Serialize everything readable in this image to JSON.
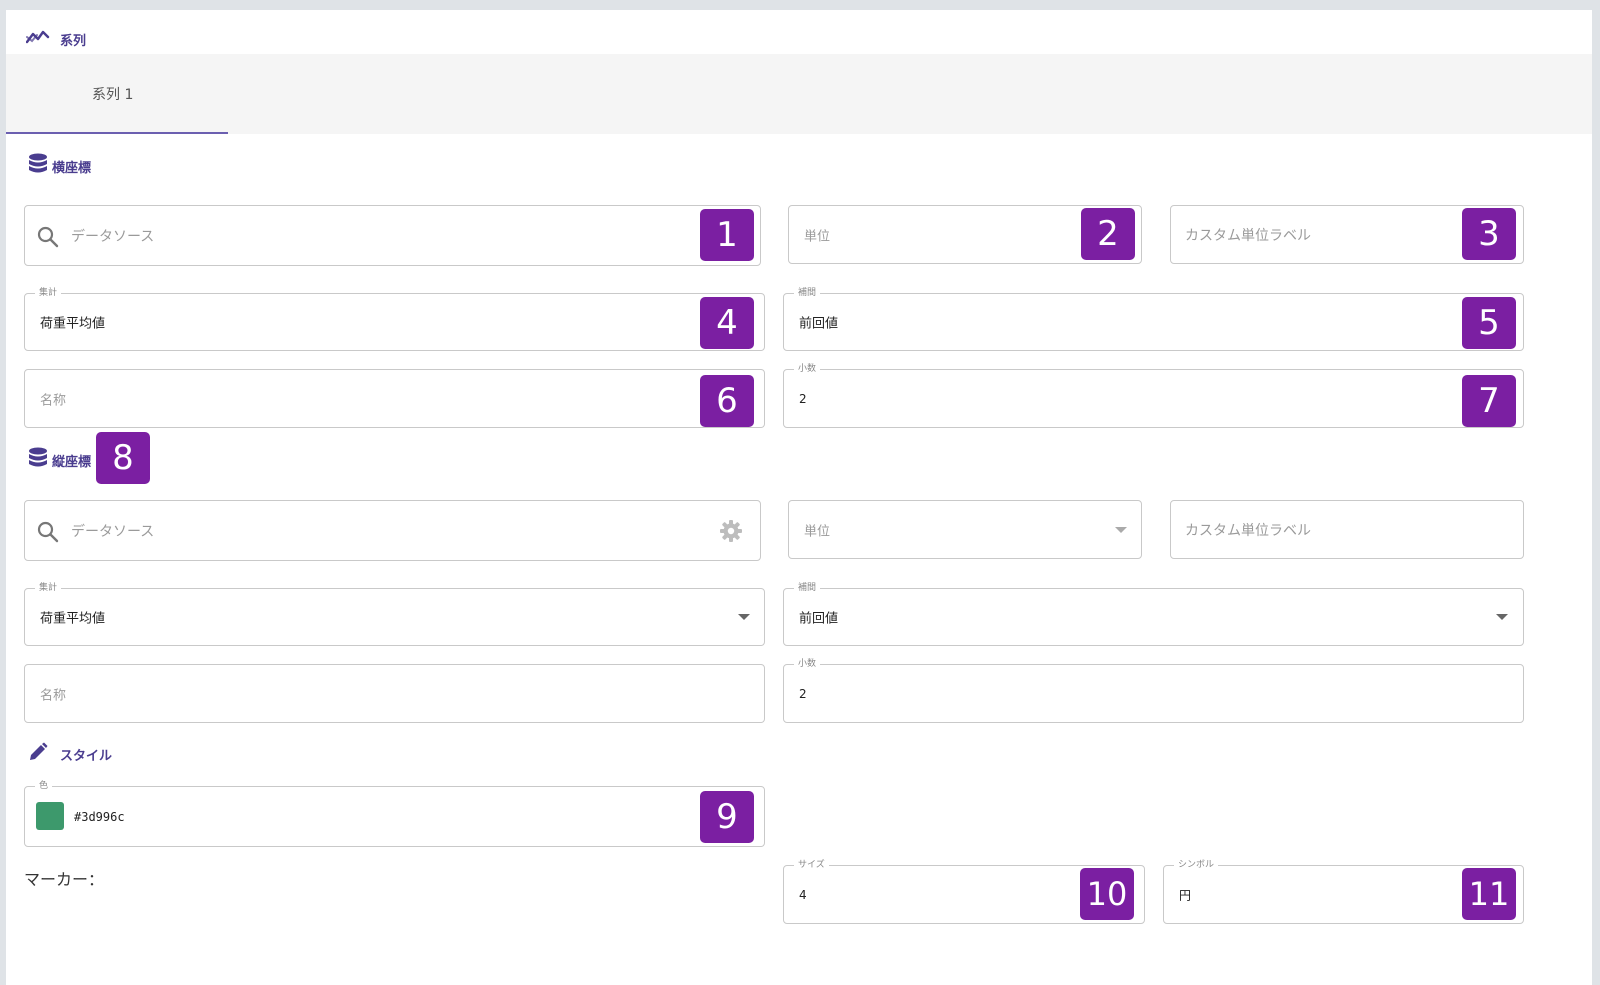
{
  "header": {
    "title": "系列",
    "icon": "chart-line-icon"
  },
  "tabs": [
    {
      "label": "系列 1",
      "active": true
    }
  ],
  "x_axis": {
    "title": "横座標",
    "icon": "database-icon",
    "datasource": {
      "placeholder": "データソース",
      "badge": "1"
    },
    "unit": {
      "placeholder": "単位",
      "badge": "2"
    },
    "custom_unit": {
      "placeholder": "カスタム単位ラベル",
      "badge": "3"
    },
    "aggregate": {
      "label": "集計",
      "value": "荷重平均値",
      "badge": "4"
    },
    "interpolation": {
      "label": "補間",
      "value": "前回値",
      "badge": "5"
    },
    "name": {
      "placeholder": "名称",
      "badge": "6"
    },
    "decimals": {
      "label": "小数",
      "value": "2",
      "badge": "7"
    }
  },
  "y_axis": {
    "title": "縦座標",
    "icon": "database-icon",
    "title_badge": "8",
    "datasource": {
      "placeholder": "データソース"
    },
    "unit": {
      "placeholder": "単位"
    },
    "custom_unit": {
      "placeholder": "カスタム単位ラベル"
    },
    "aggregate": {
      "label": "集計",
      "value": "荷重平均値"
    },
    "interpolation": {
      "label": "補間",
      "value": "前回値"
    },
    "name": {
      "placeholder": "名称"
    },
    "decimals": {
      "label": "小数",
      "value": "2"
    }
  },
  "style": {
    "title": "スタイル",
    "icon": "pencil-icon",
    "color": {
      "label": "色",
      "value": "#3d996c",
      "swatch": "#3d996c",
      "badge": "9"
    },
    "marker_label": "マーカー：",
    "size": {
      "label": "サイズ",
      "value": "4",
      "badge": "10"
    },
    "symbol": {
      "label": "シンボル",
      "value": "円",
      "badge": "11"
    }
  },
  "colors": {
    "accent": "#6b5fb0",
    "badge": "#7b1fa2"
  }
}
